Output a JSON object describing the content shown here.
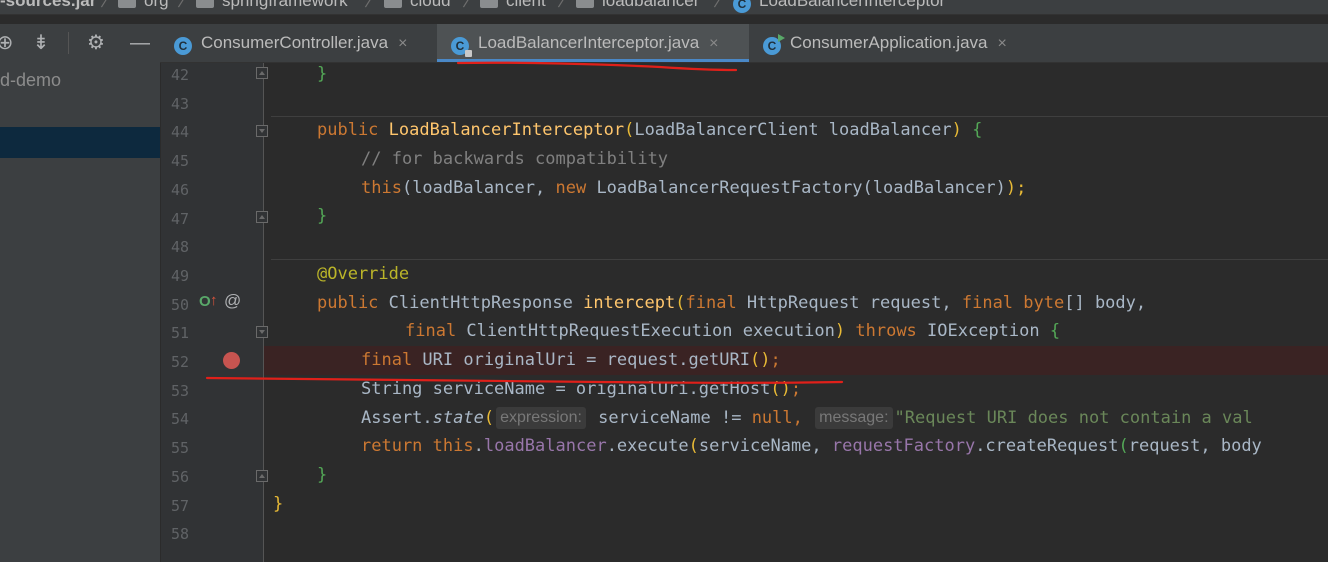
{
  "breadcrumb": {
    "jar": "-sources.jar",
    "p1": "org",
    "p2": "springframework",
    "p3": "cloud",
    "p4": "client",
    "p5": "loadbalancer",
    "cls": "LoadBalancerInterceptor",
    "class_badge": "C"
  },
  "project_panel": {
    "label": "d-demo",
    "toolbar_icons": [
      "crosshair-icon",
      "collapse-icon",
      "gear-icon",
      "minimize-icon"
    ]
  },
  "tabs": [
    {
      "label": "ConsumerController.java",
      "close": "×",
      "active": false,
      "badge": "C"
    },
    {
      "label": "LoadBalancerInterceptor.java",
      "close": "×",
      "active": true,
      "badge": "C"
    },
    {
      "label": "ConsumerApplication.java",
      "close": "×",
      "active": false,
      "badge": "C"
    }
  ],
  "editor": {
    "line_numbers": [
      "42",
      "43",
      "44",
      "45",
      "46",
      "47",
      "48",
      "49",
      "50",
      "51",
      "52",
      "53",
      "54",
      "55",
      "56",
      "57",
      "58"
    ],
    "breakpoint_line": "52",
    "gutter_marks": {
      "override": "O",
      "override_arrow": "↑",
      "annotation": "@"
    },
    "code": {
      "l42_brace": "}",
      "l44_kw": "public",
      "l44_name": "LoadBalancerInterceptor",
      "l44_paren_open": "(",
      "l44_params": "LoadBalancerClient loadBalancer",
      "l44_paren_close": ")",
      "l44_brace": "{",
      "l45_comment": "// for backwards compatibility",
      "l46_this": "this",
      "l46_a": "(loadBalancer, ",
      "l46_new": "new",
      "l46_b": " LoadBalancerRequestFactory",
      "l46_c": "(loadBalancer)",
      "l46_d": ");",
      "l47_brace": "}",
      "l49_annotation": "@Override",
      "l50_kw": "public",
      "l50_type": " ClientHttpResponse ",
      "l50_name": "intercept",
      "l50_paren": "(",
      "l50_final1": "final",
      "l50_p1": " HttpRequest request, ",
      "l50_final2": "final",
      "l50_byte": " byte",
      "l50_p2": "[] body,",
      "l51_final": "final",
      "l51_p": " ClientHttpRequestExecution execution",
      "l51_paren": ")",
      "l51_throws": " throws",
      "l51_ex": " IOException ",
      "l51_brace": "{",
      "l52_final": "final",
      "l52_rest": " URI originalUri = request.getURI",
      "l52_parens": "()",
      "l52_semi": ";",
      "l53_a": "String serviceName = originalUri.getHost",
      "l53_parens": "()",
      "l53_semi": ";",
      "l54_assert": "Assert.",
      "l54_state": "state",
      "l54_paren": "(",
      "l54_hint1": "expression:",
      "l54_expr": " serviceName != ",
      "l54_null": "null",
      "l54_comma": ",",
      "l54_hint2": "message:",
      "l54_str": "\"Request URI does not contain a val",
      "l55_return": "return",
      "l55_this": " this",
      "l55_dot": ".",
      "l55_field": "loadBalancer",
      "l55_exec": ".execute",
      "l55_paren": "(",
      "l55_sn": "serviceName, ",
      "l55_rf": "requestFactory",
      "l55_cr": ".createRequest",
      "l55_paren2": "(",
      "l55_args": "request, body",
      "l56_brace": "}",
      "l57_brace": "}"
    }
  },
  "annotation_color": "#e0201a"
}
